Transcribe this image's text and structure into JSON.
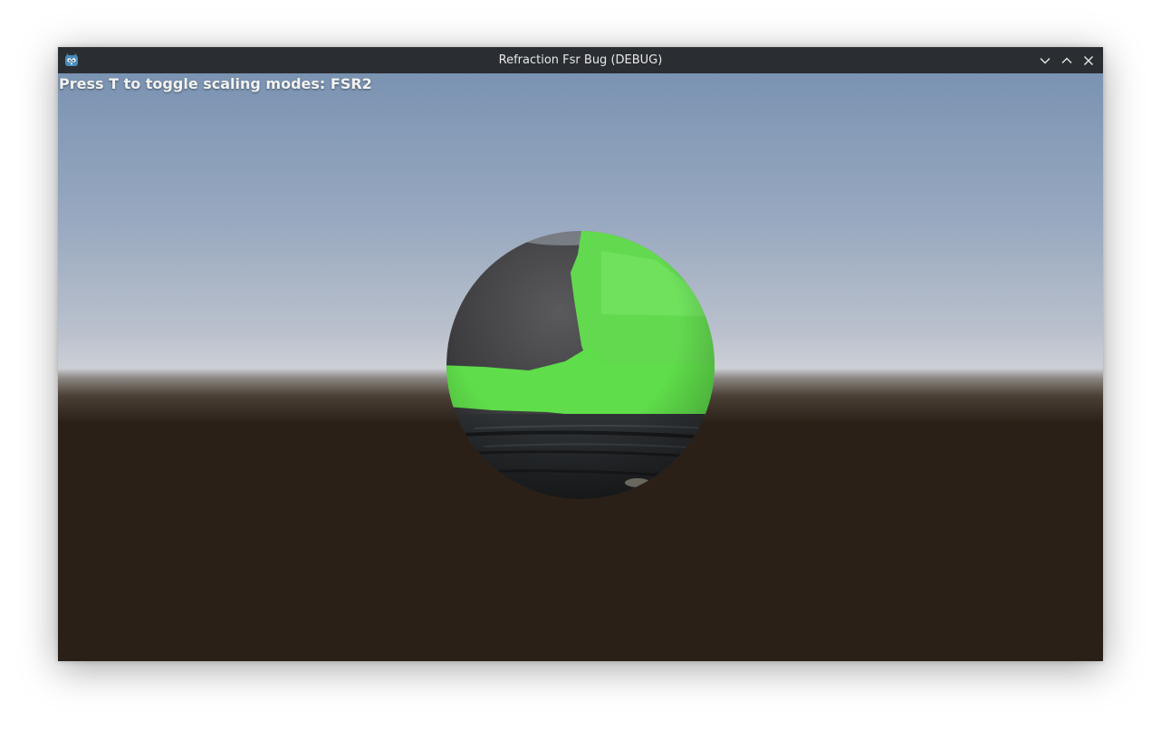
{
  "window": {
    "title": "Refraction Fsr Bug (DEBUG)",
    "app_icon": "godot-engine-icon",
    "controls": {
      "minimize_icon": "chevron-down-icon",
      "maximize_icon": "chevron-up-icon",
      "close_icon": "close-icon"
    }
  },
  "hud": {
    "message": "Press T to toggle scaling modes: FSR2"
  },
  "colors": {
    "titlebar": "#2a2e32",
    "sky_top": "#7a93b2",
    "horizon": "#c9ccd2",
    "ground": "#2a2017",
    "sphere_dark": "#3c3c3e",
    "refraction_green": "#5fe04d"
  }
}
